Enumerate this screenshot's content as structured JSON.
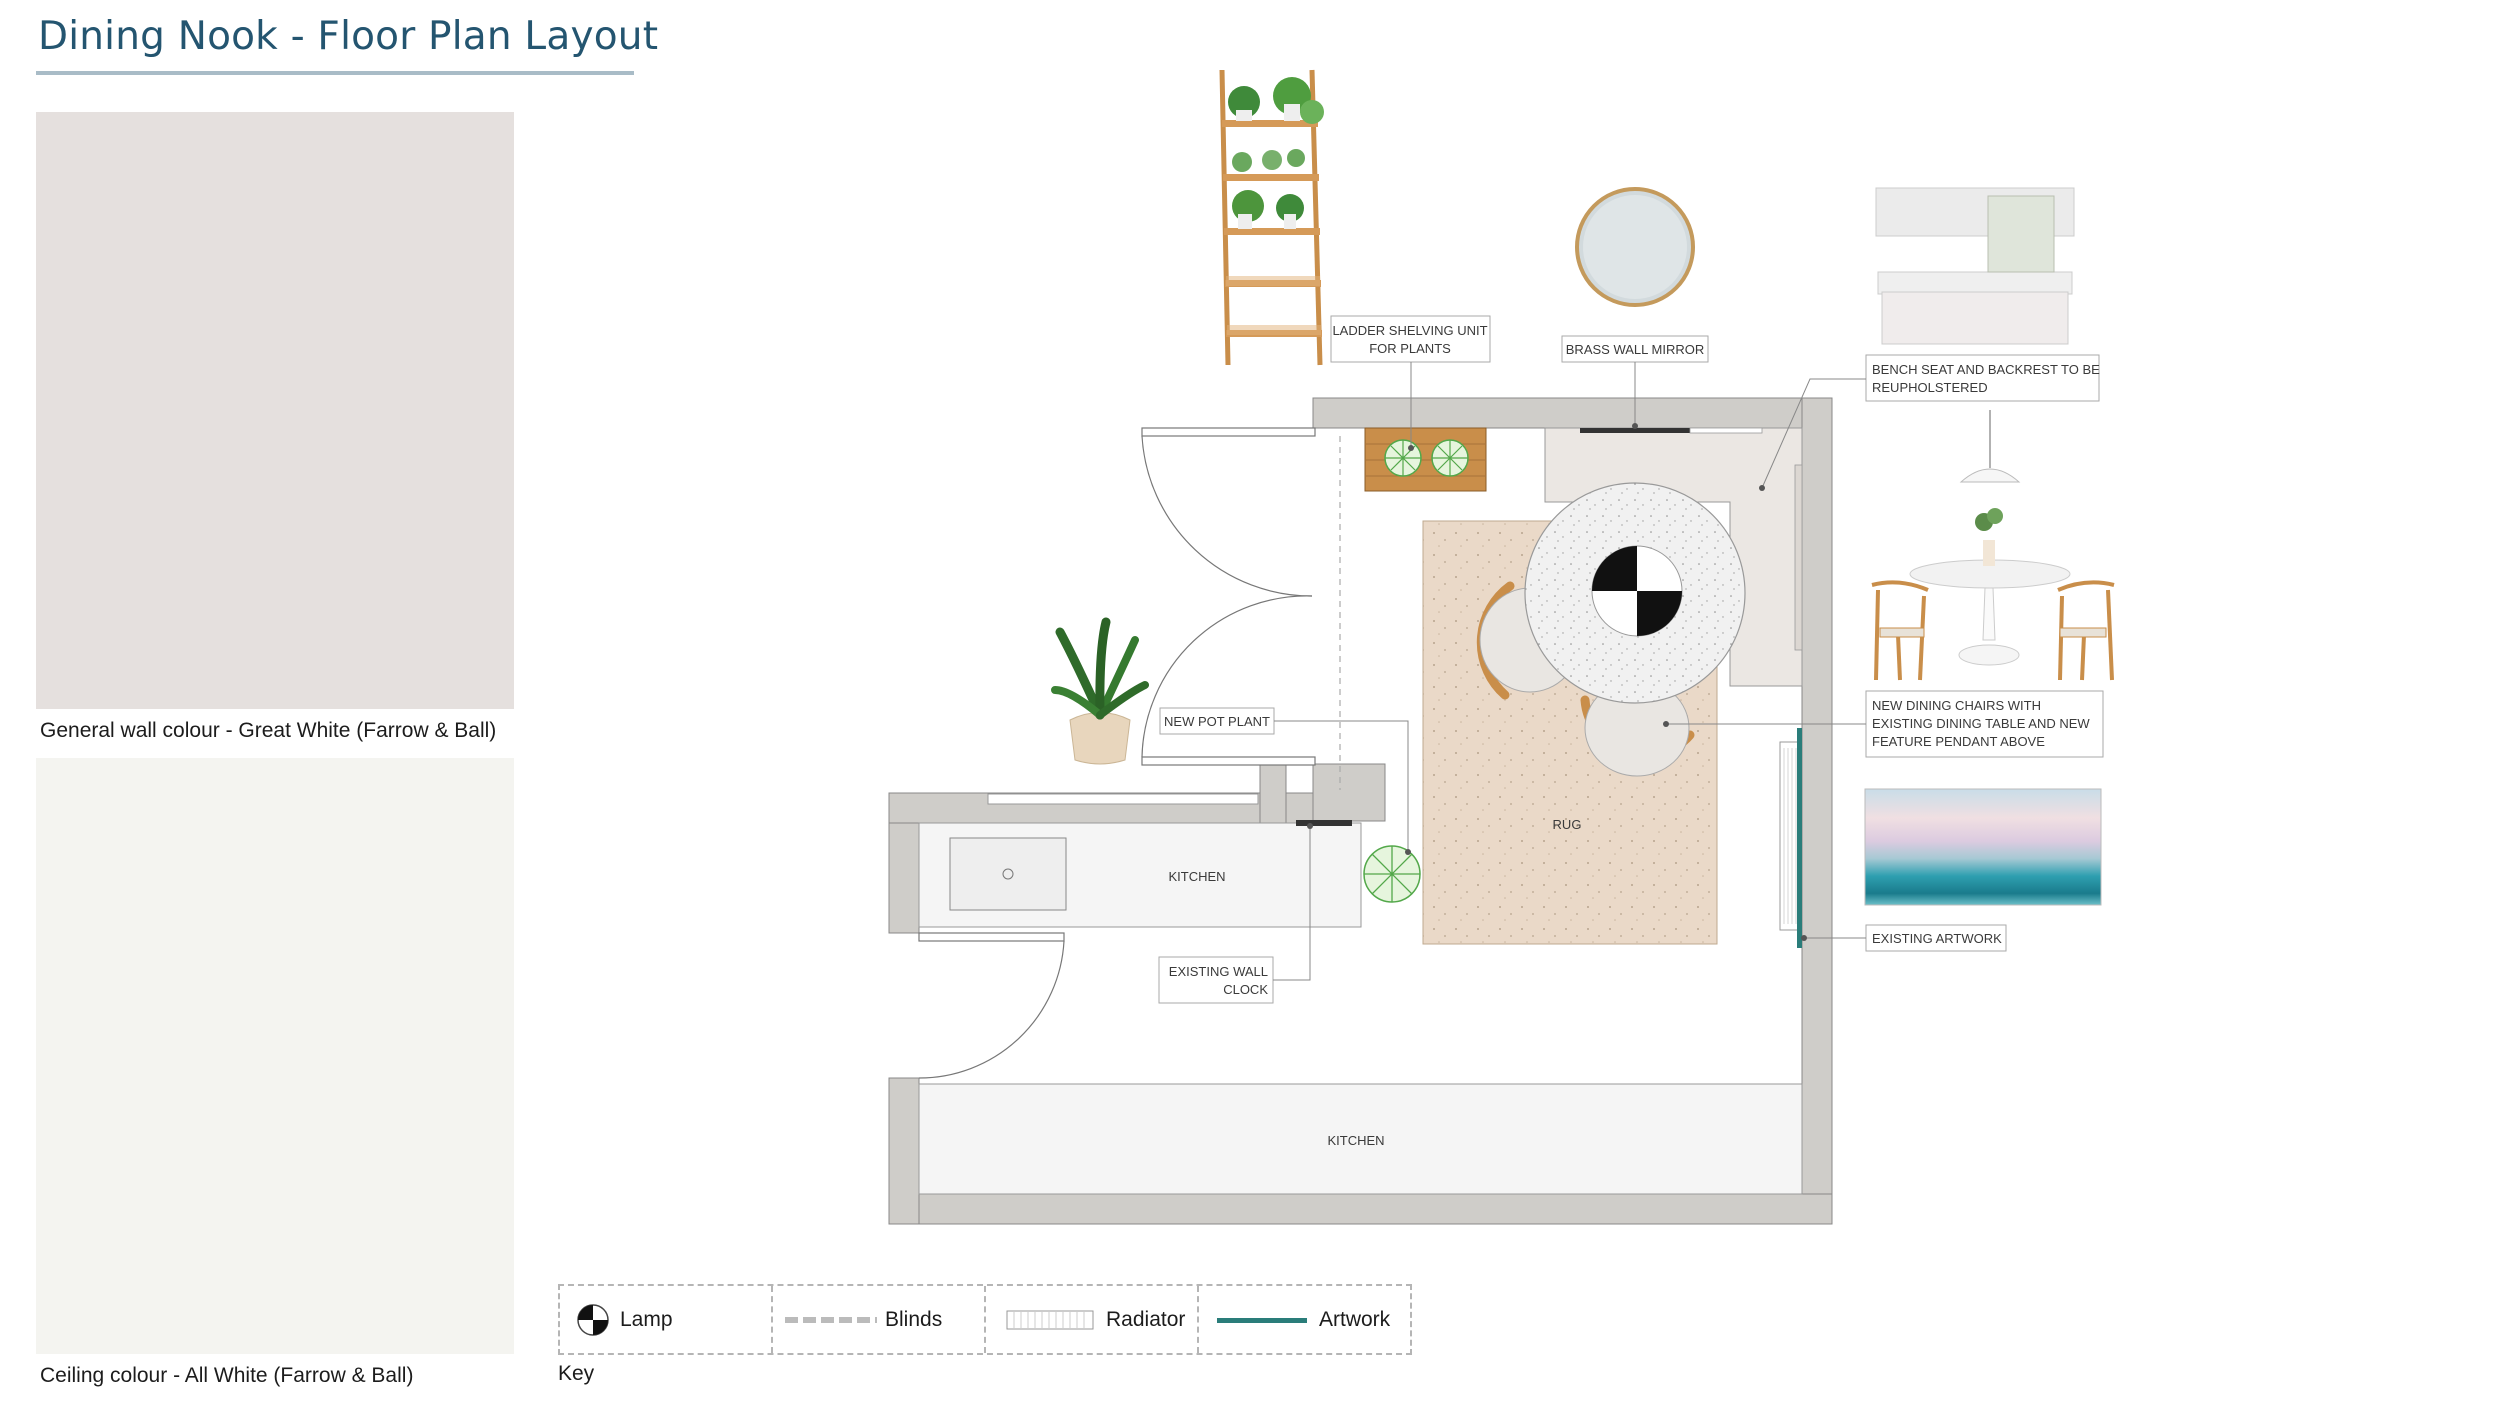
{
  "page_title": "Dining Nook - Floor Plan Layout",
  "swatches": {
    "wall": {
      "caption": "General wall colour - Great White (Farrow & Ball)",
      "color": "#e5e0de"
    },
    "ceiling": {
      "caption": "Ceiling colour - All White (Farrow & Ball)",
      "color": "#f4f4f0"
    }
  },
  "plan_labels": {
    "ladder_line1": "LADDER SHELVING UNIT",
    "ladder_line2": "FOR PLANTS",
    "mirror": "BRASS WALL MIRROR",
    "bench_line1": "BENCH SEAT AND BACKREST TO BE",
    "bench_line2": "REUPHOLSTERED",
    "pot_plant": "NEW POT PLANT",
    "chairs_line1": "NEW DINING CHAIRS WITH",
    "chairs_line2": "EXISTING DINING TABLE AND NEW",
    "chairs_line3": "FEATURE PENDANT ABOVE",
    "kitchen_upper": "KITCHEN",
    "kitchen_lower": "KITCHEN",
    "rug": "RUG",
    "clock_line1": "EXISTING WALL",
    "clock_line2": "CLOCK",
    "artwork": "EXISTING ARTWORK"
  },
  "legend": {
    "lamp": "Lamp",
    "blinds": "Blinds",
    "radiator": "Radiator",
    "artwork": "Artwork",
    "key": "Key"
  },
  "colors": {
    "title": "#245570",
    "wall": "#cfcdc9",
    "rug": "#ead9c8",
    "artwork_line": "#2a7d7a",
    "chair_wood": "#c98e4a"
  }
}
